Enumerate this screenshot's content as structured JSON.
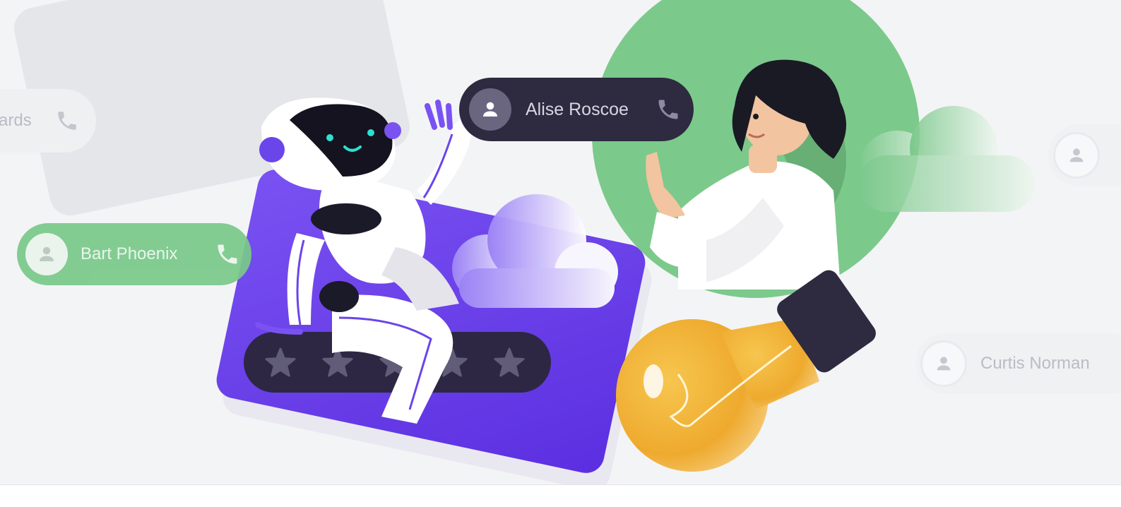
{
  "contacts": {
    "alise": {
      "name": "Alise Roscoe"
    },
    "bart": {
      "name": "Bart Phoenix"
    },
    "curtis": {
      "name": "Curtis Norman"
    },
    "edwards": {
      "name": "ards"
    }
  },
  "rating": {
    "stars_total": 5
  },
  "colors": {
    "purple": "#6a45ea",
    "green": "#7cc98c",
    "dark_pill": "#2e2a40",
    "bulb": "#f0b23a",
    "background": "#f3f4f6"
  },
  "icons": [
    "user-icon",
    "phone-icon",
    "star-icon",
    "robot",
    "woman",
    "lightbulb",
    "cloud"
  ]
}
